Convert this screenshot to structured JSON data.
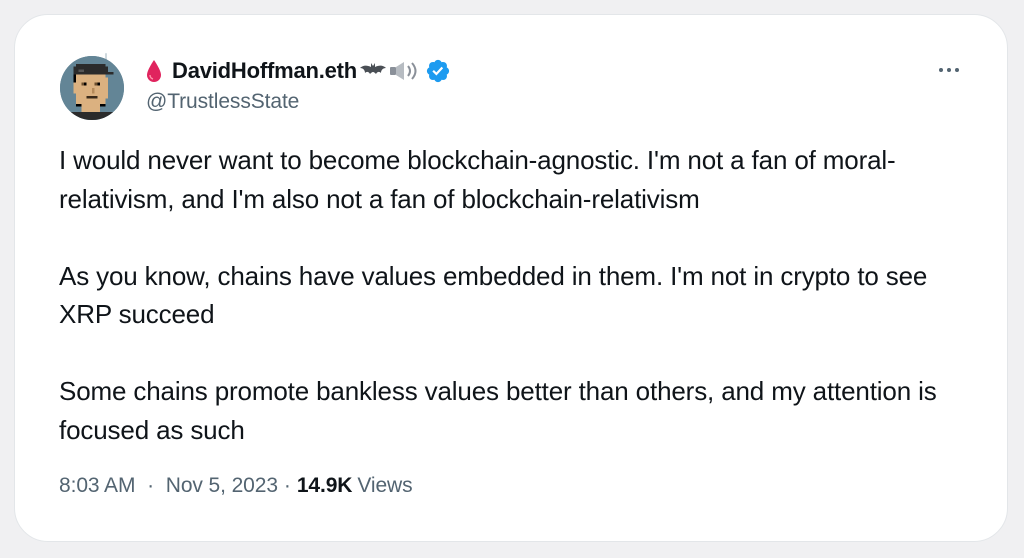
{
  "tweet": {
    "author": {
      "display_name": "DavidHoffman.eth",
      "handle": "@TrustlessState",
      "verified": true,
      "name_prefix_icon": "blood-drop-icon",
      "name_suffix_icons": [
        "bat-icon",
        "speaker-icon"
      ],
      "avatar_icon": "pixel-punk-avatar"
    },
    "paragraphs": [
      "I would never want to become blockchain-agnostic. I'm not a fan of moral-relativism, and I'm also not a fan of blockchain-relativism",
      "As you know, chains have values embedded in them. I'm not in crypto to see XRP succeed",
      "Some chains promote bankless values better than others, and my attention is focused as such"
    ],
    "time": "8:03 AM",
    "separator": "·",
    "date": "Nov 5, 2023",
    "views_count": "14.9K",
    "views_label": "Views"
  },
  "colors": {
    "text_primary": "#0f1419",
    "text_secondary": "#536471",
    "verified_blue": "#1d9bf0",
    "card_background": "#ffffff",
    "page_background": "#f0f0f2"
  }
}
